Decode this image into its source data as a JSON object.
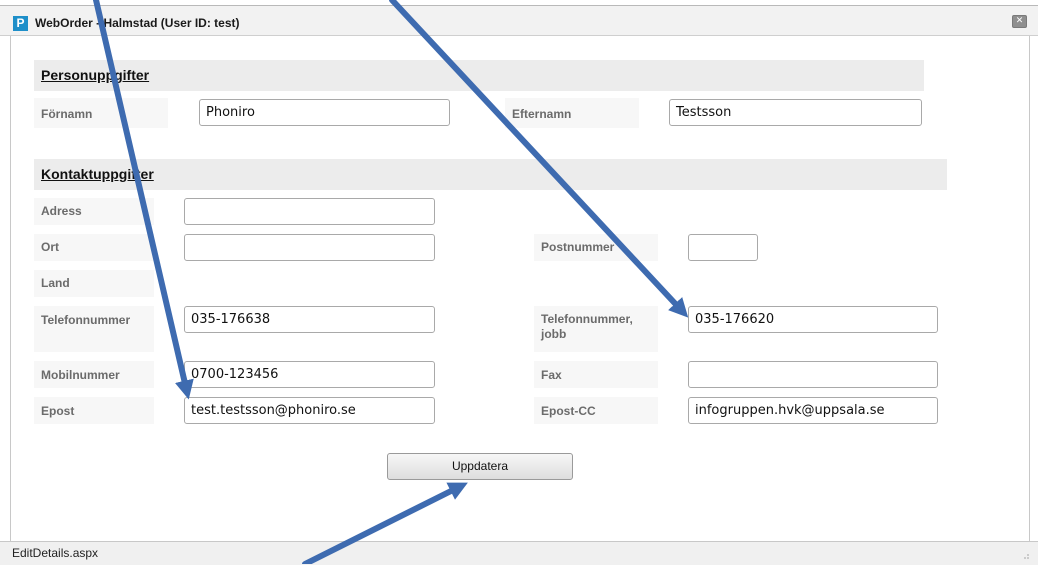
{
  "window": {
    "app_icon_letter": "P",
    "title": "WebOrder - Halmstad (User ID: test)",
    "close_glyph": "✕"
  },
  "sections": {
    "personal_title": "Personuppgifter",
    "contact_title": "Kontaktuppgifter"
  },
  "fields": {
    "fornamn": {
      "label": "Förnamn",
      "value": "Phoniro"
    },
    "efternamn": {
      "label": "Efternamn",
      "value": "Testsson"
    },
    "adress": {
      "label": "Adress",
      "value": ""
    },
    "ort": {
      "label": "Ort",
      "value": ""
    },
    "postnummer": {
      "label": "Postnummer",
      "value": ""
    },
    "land": {
      "label": "Land"
    },
    "telefonnummer": {
      "label": "Telefonnummer",
      "value": "035-176638"
    },
    "telefonnummer_jobb": {
      "label": "Telefonnummer, jobb",
      "value": "035-176620"
    },
    "mobilnummer": {
      "label": "Mobilnummer",
      "value": "0700-123456"
    },
    "fax": {
      "label": "Fax",
      "value": ""
    },
    "epost": {
      "label": "Epost",
      "value": "test.testsson@phoniro.se"
    },
    "epost_cc": {
      "label": "Epost-CC",
      "value": "infogruppen.hvk@uppsala.se"
    }
  },
  "buttons": {
    "update": "Uppdatera"
  },
  "statusbar": {
    "text": "EditDetails.aspx"
  },
  "colors": {
    "annotation_arrow": "#3e6bb0",
    "app_icon": "#1e8fc9",
    "section_header_bg": "#ececec",
    "label_text": "#6b6b6b"
  },
  "icons": {
    "app_icon": "weborder-app-icon",
    "close": "close-icon",
    "resize_grip": "resize-grip-icon"
  }
}
